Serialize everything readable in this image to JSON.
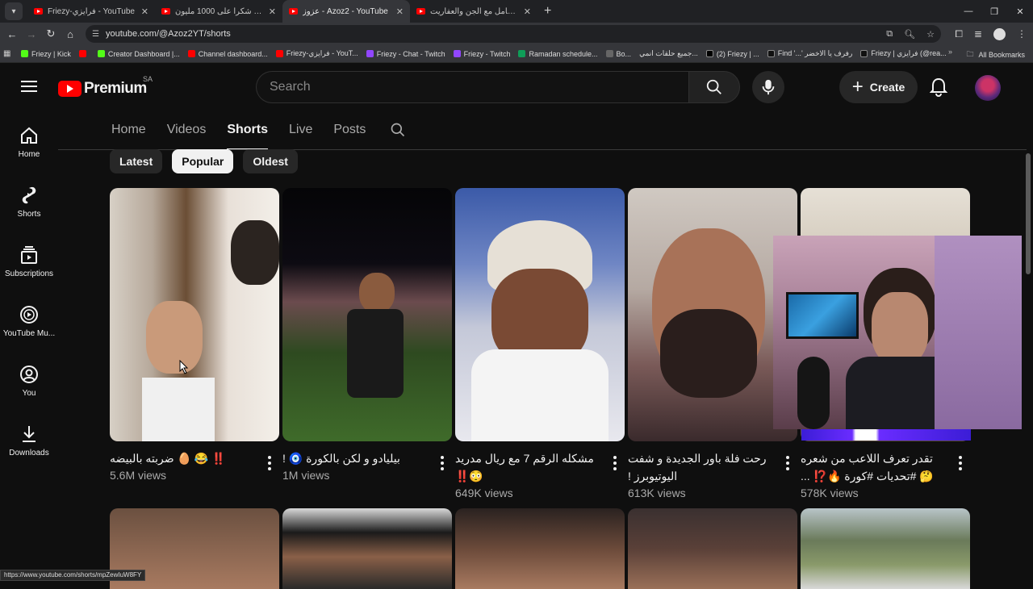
{
  "browser": {
    "tabs": [
      {
        "title": "Friezy-فرايزي - YouTube",
        "active": false
      },
      {
        "title": "رحلتنا 💯| #1 | شكرا على 1000 مليون ...",
        "active": false
      },
      {
        "title": "عزوز - Azoz2 - YouTube",
        "active": true
      },
      {
        "title": "حارس امن يتعامل مع الجن والعفاريت ...",
        "active": false
      }
    ],
    "url": "youtube.com/@Azoz2YT/shorts",
    "bookmarks": [
      {
        "label": "Friezy | Kick",
        "color": "#53fc18"
      },
      {
        "label": "",
        "color": "#ff0000"
      },
      {
        "label": "Creator Dashboard |...",
        "color": "#53fc18"
      },
      {
        "label": "Channel dashboard...",
        "color": "#ff0000"
      },
      {
        "label": "Friezy-فرايزي - YouT...",
        "color": "#ff0000"
      },
      {
        "label": "Friezy - Chat - Twitch",
        "color": "#9146ff"
      },
      {
        "label": "Friezy - Twitch",
        "color": "#9146ff"
      },
      {
        "label": "Ramadan schedule...",
        "color": "#0f9d58"
      },
      {
        "label": "Bo...",
        "color": "#666666"
      },
      {
        "label": "جميع حلقات انمي...",
        "color": "#444444"
      },
      {
        "label": "(2) Friezy | ...",
        "color": "#000000"
      },
      {
        "label": "Find '...' رفرف يا الاخضر",
        "color": "#111111"
      },
      {
        "label": "Friezy | فرايزي (@rea...",
        "color": "#111111"
      }
    ],
    "all_bookmarks": "All Bookmarks",
    "status_url": "https://www.youtube.com/shorts/mpZewIuW8FY"
  },
  "header": {
    "logo_text": "Premium",
    "country": "SA",
    "search_placeholder": "Search",
    "create_label": "Create"
  },
  "sidebar": {
    "items": [
      {
        "label": "Home",
        "icon": "home-icon"
      },
      {
        "label": "Shorts",
        "icon": "shorts-icon"
      },
      {
        "label": "Subscriptions",
        "icon": "subscriptions-icon"
      },
      {
        "label": "YouTube Mu...",
        "icon": "youtube-music-icon"
      },
      {
        "label": "You",
        "icon": "you-icon"
      },
      {
        "label": "Downloads",
        "icon": "downloads-icon"
      }
    ]
  },
  "channel_tabs": [
    "Home",
    "Videos",
    "Shorts",
    "Live",
    "Posts"
  ],
  "active_tab": "Shorts",
  "chips": [
    {
      "label": "Latest",
      "active": false
    },
    {
      "label": "Popular",
      "active": true
    },
    {
      "label": "Oldest",
      "active": false
    }
  ],
  "shorts": [
    {
      "title": "‼️ 😂 🥚 ضربته بالبيضه",
      "views": "5.6M views"
    },
    {
      "title": "بيليادو و لكن بالكورة 🧿 !",
      "views": "1M views"
    },
    {
      "title": "مشكله الرقم 7 مع ريال مدريد 😳‼️",
      "views": "649K views"
    },
    {
      "title": "رحت فلة باور الجديدة و شفت اليوتيوبرز !",
      "views": "613K views"
    },
    {
      "title": "تقدر تعرف اللاعب من شعره 🤔 #تحديات #كورة 🔥⁉️ ...",
      "views": "578K views"
    }
  ]
}
